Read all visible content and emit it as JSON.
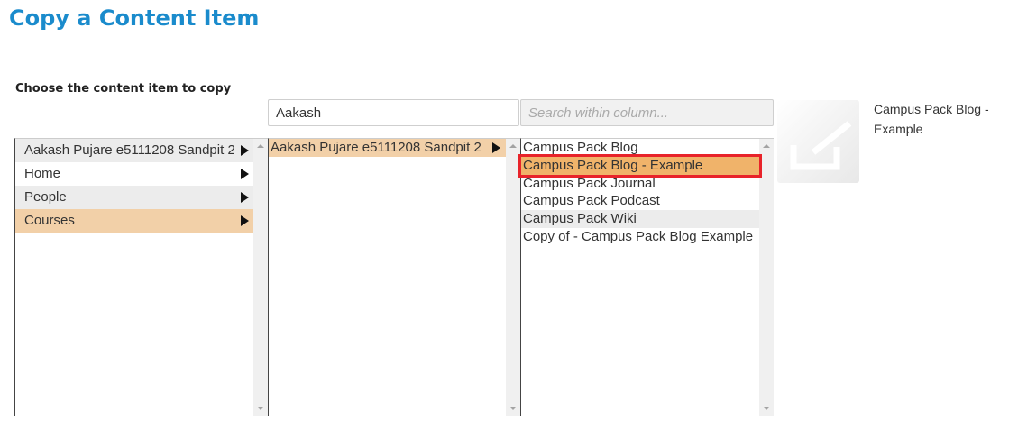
{
  "page": {
    "title": "Copy a Content Item"
  },
  "chooser": {
    "label": "Choose the content item to copy",
    "search_value": "Aakash",
    "column_search_placeholder": "Search within column..."
  },
  "columns": [
    {
      "items": [
        {
          "label": "Aakash Pujare e5111208 Sandpit 2",
          "has_children": true,
          "selected": false
        },
        {
          "label": "Home",
          "has_children": true,
          "selected": false
        },
        {
          "label": "People",
          "has_children": true,
          "selected": false
        },
        {
          "label": "Courses",
          "has_children": true,
          "selected": true
        }
      ]
    },
    {
      "items": [
        {
          "label": "Aakash Pujare e5111208 Sandpit 2",
          "has_children": true,
          "selected": true
        }
      ]
    },
    {
      "items": [
        {
          "label": "Campus Pack Blog",
          "selected": false
        },
        {
          "label": "Campus Pack Blog - Example",
          "selected": true
        },
        {
          "label": "Campus Pack Journal",
          "selected": false
        },
        {
          "label": "Campus Pack Podcast",
          "selected": false
        },
        {
          "label": "Campus Pack Wiki",
          "selected": false
        },
        {
          "label": "Copy of - Campus Pack Blog Example",
          "selected": false
        }
      ]
    }
  ],
  "preview": {
    "title": "Campus Pack Blog - Example",
    "icon": "edit-document-icon"
  },
  "colors": {
    "title": "#1a8bcc",
    "selected_path": "#f2d0a8",
    "selected_item": "#f0b36a",
    "highlight_border": "#e8232a"
  }
}
